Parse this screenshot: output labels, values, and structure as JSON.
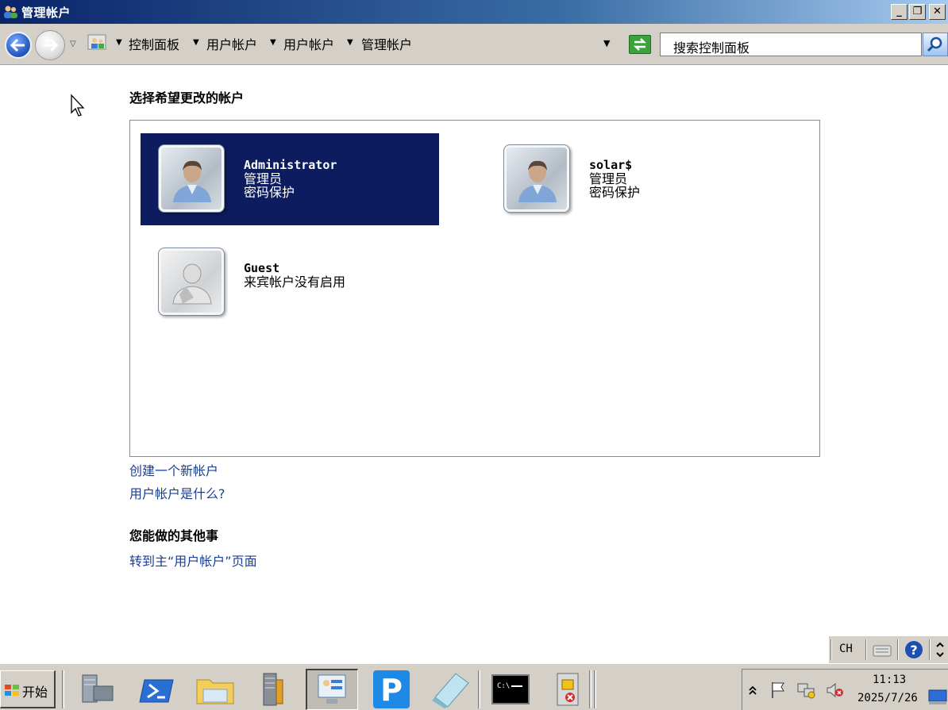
{
  "window": {
    "title": "管理帐户"
  },
  "address": {
    "breadcrumbs": [
      "控制面板",
      "用户帐户",
      "用户帐户",
      "管理帐户"
    ],
    "search_placeholder": "搜索控制面板"
  },
  "main": {
    "heading": "选择希望更改的帐户",
    "accounts": [
      {
        "name": "Administrator",
        "role": "管理员",
        "status": "密码保护",
        "selected": true
      },
      {
        "name": "solar$",
        "role": "管理员",
        "status": "密码保护",
        "selected": false
      },
      {
        "name": "Guest",
        "status": "来宾帐户没有启用",
        "selected": false
      }
    ],
    "links": {
      "create_account": "创建一个新帐户",
      "what_is_account": "用户帐户是什么?"
    },
    "other_heading": "您能做的其他事",
    "other_link": "转到主“用户帐户”页面"
  },
  "langbar": {
    "lang": "CH"
  },
  "taskbar": {
    "start_label": "开始",
    "clock_time": "11:13",
    "clock_date": "2025/7/26"
  },
  "colors": {
    "selected_bg": "#0d1c5e",
    "link": "#1a3e96",
    "titlebar": "#0a246a"
  }
}
